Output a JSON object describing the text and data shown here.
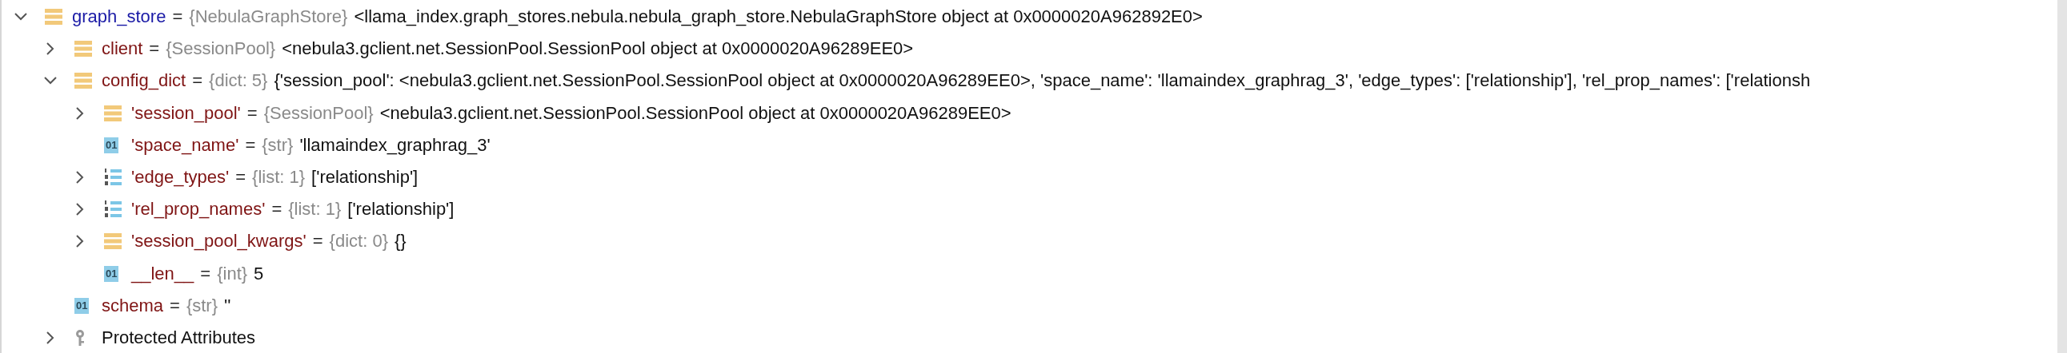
{
  "variables": [
    {
      "name": "graph_store",
      "separator": "=",
      "type": "{NebulaGraphStore}",
      "value": "<llama_index.graph_stores.nebula.nebula_graph_store.NebulaGraphStore object at 0x0000020A962892E0>",
      "kind": "object",
      "expanded": true,
      "children": [
        {
          "name": "client",
          "separator": "=",
          "type": "{SessionPool}",
          "value": "<nebula3.gclient.net.SessionPool.SessionPool object at 0x0000020A96289EE0>",
          "kind": "object",
          "expanded": false
        },
        {
          "name": "config_dict",
          "separator": "=",
          "type": "{dict: 5}",
          "value": "{'session_pool': <nebula3.gclient.net.SessionPool.SessionPool object at 0x0000020A96289EE0>, 'space_name': 'llamaindex_graphrag_3', 'edge_types': ['relationship'], 'rel_prop_names': ['relationsh",
          "kind": "object",
          "expanded": true,
          "children": [
            {
              "name": "'session_pool'",
              "separator": "=",
              "type": "{SessionPool}",
              "value": "<nebula3.gclient.net.SessionPool.SessionPool object at 0x0000020A96289EE0>",
              "kind": "object",
              "expanded": false
            },
            {
              "name": "'space_name'",
              "separator": "=",
              "type": "{str}",
              "value": "'llamaindex_graphrag_3'",
              "kind": "scalar",
              "badge": "01"
            },
            {
              "name": "'edge_types'",
              "separator": "=",
              "type": "{list: 1}",
              "value": "['relationship']",
              "kind": "list",
              "expanded": false
            },
            {
              "name": "'rel_prop_names'",
              "separator": "=",
              "type": "{list: 1}",
              "value": "['relationship']",
              "kind": "list",
              "expanded": false
            },
            {
              "name": "'session_pool_kwargs'",
              "separator": "=",
              "type": "{dict: 0}",
              "value": "{}",
              "kind": "object",
              "expanded": false
            },
            {
              "name": "__len__",
              "separator": "=",
              "type": "{int}",
              "value": "5",
              "kind": "scalar",
              "badge": "01"
            }
          ]
        },
        {
          "name": "schema",
          "separator": "=",
          "type": "{str}",
          "value": "''",
          "kind": "scalar",
          "badge": "01"
        },
        {
          "name": "Protected Attributes",
          "kind": "group",
          "expanded": false
        }
      ]
    }
  ]
}
